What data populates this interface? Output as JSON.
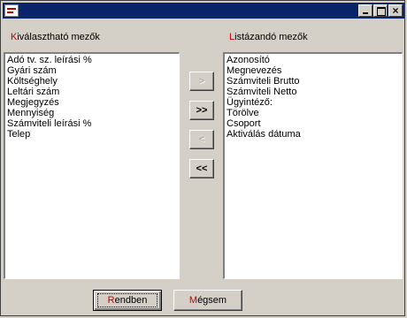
{
  "window": {
    "title": ""
  },
  "available": {
    "label_hot": "K",
    "label_rest": "iválasztható mezők",
    "items": [
      "Adó tv. sz. leírási %",
      "Gyári szám",
      "Költséghely",
      "Leltári szám",
      "Megjegyzés",
      "Mennyiség",
      "Számviteli leírási %",
      "Telep"
    ]
  },
  "listed": {
    "label_hot": "L",
    "label_rest": "istázandó mezők",
    "items": [
      "Azonosító",
      "Megnevezés",
      "Számviteli Brutto",
      "Számviteli Netto",
      "Ügyintéző:",
      "Törölve",
      "Csoport",
      "Aktiválás dátuma"
    ]
  },
  "buttons": {
    "move_right": ">",
    "move_all_right": ">>",
    "move_left": "<",
    "move_all_left": "<<",
    "ok_hot": "R",
    "ok_rest": "endben",
    "cancel_hot": "M",
    "cancel_rest": "égsem"
  }
}
